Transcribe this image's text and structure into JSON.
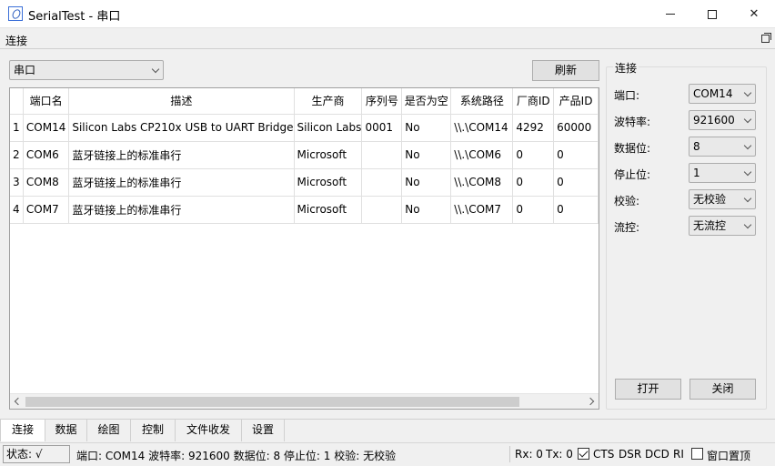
{
  "window": {
    "title": "SerialTest - 串口"
  },
  "dock": {
    "title": "连接"
  },
  "top": {
    "port_type": "串口",
    "refresh_label": "刷新"
  },
  "table": {
    "headers": [
      "端口名",
      "描述",
      "生产商",
      "序列号",
      "是否为空",
      "系统路径",
      "厂商ID",
      "产品ID"
    ],
    "rows": [
      {
        "num": "1",
        "cells": [
          "COM14",
          "Silicon Labs CP210x USB to UART Bridge",
          "Silicon Labs",
          "0001",
          "No",
          "\\\\.\\COM14",
          "4292",
          "60000"
        ]
      },
      {
        "num": "2",
        "cells": [
          "COM6",
          "蓝牙链接上的标准串行",
          "Microsoft",
          "",
          "No",
          "\\\\.\\COM6",
          "0",
          "0"
        ]
      },
      {
        "num": "3",
        "cells": [
          "COM8",
          "蓝牙链接上的标准串行",
          "Microsoft",
          "",
          "No",
          "\\\\.\\COM8",
          "0",
          "0"
        ]
      },
      {
        "num": "4",
        "cells": [
          "COM7",
          "蓝牙链接上的标准串行",
          "Microsoft",
          "",
          "No",
          "\\\\.\\COM7",
          "0",
          "0"
        ]
      }
    ]
  },
  "settings": {
    "group_title": "连接",
    "port_label": "端口:",
    "port_value": "COM14",
    "baud_label": "波特率:",
    "baud_value": "921600",
    "databits_label": "数据位:",
    "databits_value": "8",
    "stopbits_label": "停止位:",
    "stopbits_value": "1",
    "parity_label": "校验:",
    "parity_value": "无校验",
    "flow_label": "流控:",
    "flow_value": "无流控",
    "open_label": "打开",
    "close_label": "关闭"
  },
  "tabs": [
    "连接",
    "数据",
    "绘图",
    "控制",
    "文件收发",
    "设置"
  ],
  "status": {
    "state": "状态: √",
    "info": "端口: COM14 波特率: 921600 数据位: 8 停止位: 1 校验: 无校验",
    "rx": "Rx: 0",
    "tx": "Tx: 0",
    "cts": "CTS",
    "dsr": "DSR",
    "dcd": "DCD",
    "ri": "RI",
    "topmost": "窗口置顶"
  }
}
